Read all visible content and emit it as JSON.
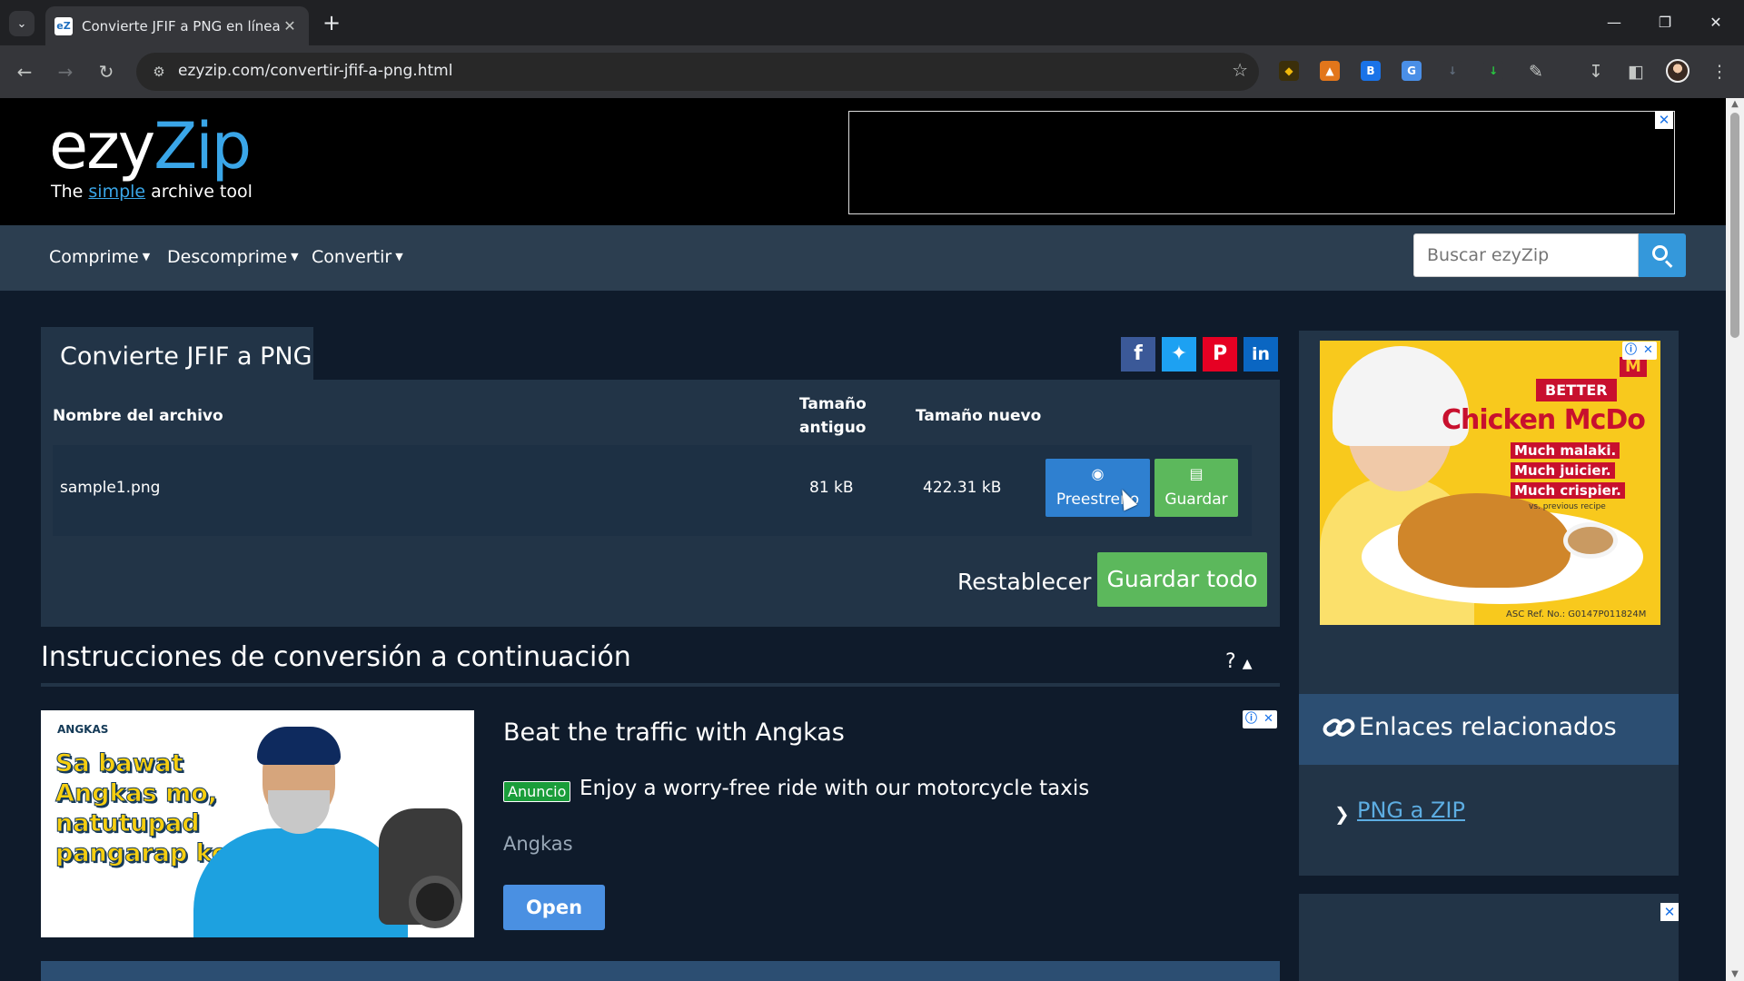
{
  "browser": {
    "tab_title": "Convierte JFIF a PNG en línea (g",
    "tab_favicon": "eZ",
    "url": "ezyzip.com/convertir-jfif-a-png.html"
  },
  "site": {
    "logo_ezy": "ezy",
    "logo_zip": "Zip",
    "tagline_pre": "The ",
    "tagline_simple": "simple",
    "tagline_post": " archive tool",
    "nav": [
      "Comprime",
      "Descomprime",
      "Convertir"
    ],
    "search_placeholder": "Buscar ezyZip"
  },
  "converter": {
    "title": "Convierte JFIF a PNG",
    "columns": {
      "filename": "Nombre del archivo",
      "old_size": "Tamaño antiguo",
      "new_size": "Tamaño nuevo"
    },
    "rows": [
      {
        "name": "sample1.png",
        "old_size": "81 kB",
        "new_size": "422.31 kB"
      }
    ],
    "preview_label": "Preestreno",
    "save_label": "Guardar",
    "reset_label": "Restablecer",
    "save_all_label": "Guardar todo",
    "instructions_title": "Instrucciones de conversión a continuación",
    "instructions_toggle": "?"
  },
  "ad": {
    "brand": "ANGKAS",
    "slogan": [
      "Sa bawat",
      "Angkas mo,",
      "natutupad",
      "pangarap ko."
    ],
    "headline": "Beat the traffic with Angkas",
    "label": "Anuncio",
    "description": "Enjoy a worry-free ride with our motorcycle taxis",
    "advertiser": "Angkas",
    "button": "Open"
  },
  "sidebar": {
    "mcdo": {
      "better": "BETTER",
      "title": "Chicken McDo",
      "lines": [
        "Much malaki.",
        "Much juicier.",
        "Much crispier."
      ],
      "note": "vs. previous recipe",
      "ref": "ASC Ref. No.: G0147P011824M",
      "logo": "M"
    },
    "related_title": "Enlaces relacionados",
    "related_links": [
      "PNG a ZIP"
    ]
  },
  "colors": {
    "page_bg": "#0f1b2b",
    "card_bg": "#223447",
    "navbar_bg": "#2c3e50",
    "accent_blue": "#3498db",
    "success_green": "#5cb85c"
  }
}
